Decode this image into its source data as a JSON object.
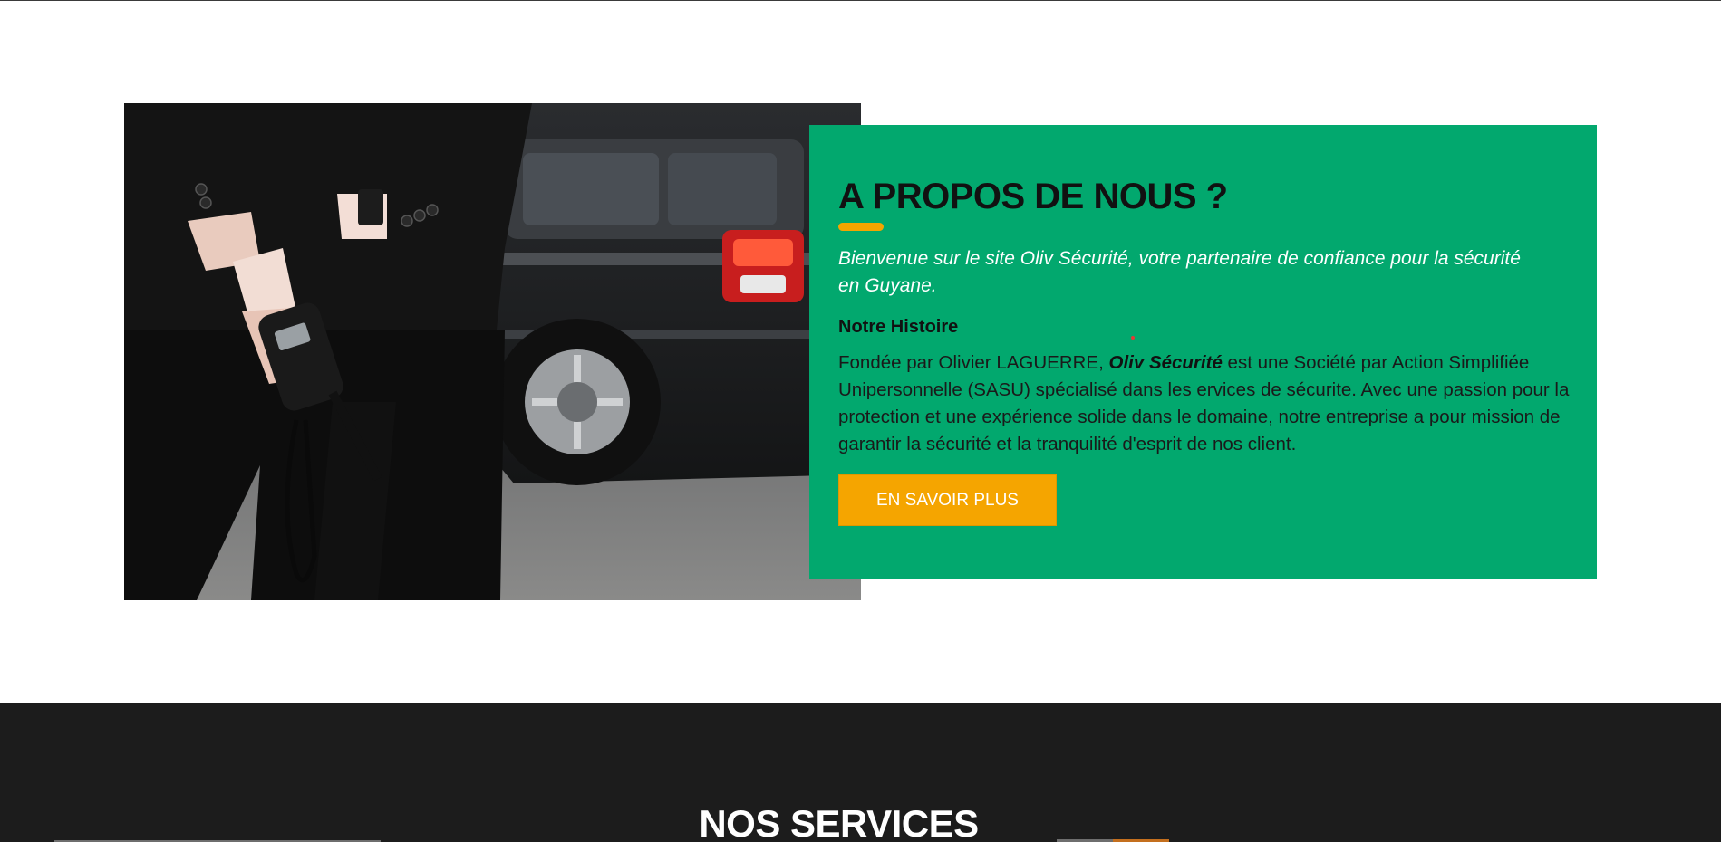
{
  "about": {
    "title": "A PROPOS DE NOUS ?",
    "intro": "Bienvenue sur le site Oliv Sécurité, votre partenaire de confiance pour la sécurité en Guyane.",
    "history_heading": "Notre Histoire",
    "history_prefix": "Fondée par Olivier LAGUERRE, ",
    "history_brand": "Oliv Sécurité",
    "history_body": " est une Société par Action Simplifiée Unipersonnelle (SASU) spécialisé dans les ervices de sécurite. Avec une passion pour la protection et une expérience solide dans le domaine, notre entreprise a pour mission de garantir la sécurité et la tranquilité d'esprit de nos client.",
    "cta_label": "EN SAVOIR PLUS"
  },
  "services": {
    "title": "NOS SERVICES"
  },
  "colors": {
    "card_green": "#02a86e",
    "accent_orange": "#f5a500",
    "dark_band": "#1c1c1c"
  }
}
